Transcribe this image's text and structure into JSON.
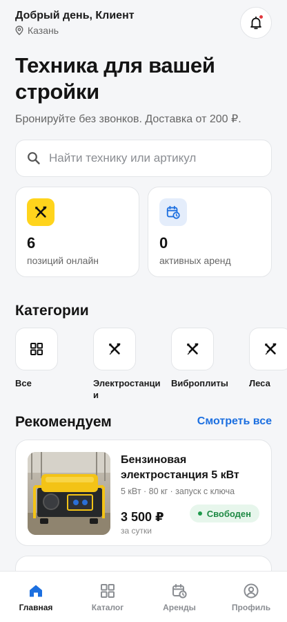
{
  "header": {
    "greeting": "Добрый день, Клиент",
    "city": "Казань",
    "has_notifications": true
  },
  "hero": {
    "title": "Техника для вашей стройки",
    "subtitle": "Бронируйте без звонков. Доставка от 200 ₽."
  },
  "search": {
    "placeholder": "Найти технику или артикул",
    "value": ""
  },
  "stats": [
    {
      "value": "6",
      "label": "позиций онлайн",
      "icon": "tools-icon",
      "color": "#ffd41c"
    },
    {
      "value": "0",
      "label": "активных аренд",
      "icon": "calendar-clock-icon",
      "color": "#e4edfb"
    }
  ],
  "categories": {
    "title": "Категории",
    "items": [
      {
        "label": "Все",
        "icon": "grid-icon"
      },
      {
        "label": "Электростанции",
        "icon": "tools-icon"
      },
      {
        "label": "Виброплиты",
        "icon": "tools-icon"
      },
      {
        "label": "Леса",
        "icon": "tools-icon"
      }
    ]
  },
  "recommended": {
    "title": "Рекомендуем",
    "see_all": "Смотреть все",
    "products": [
      {
        "title": "Бензиновая электростанция 5 кВт",
        "specs": "5 кВт · 80 кг · запуск с ключа",
        "price": "3 500 ₽",
        "unit": "за сутки",
        "status": "Свободен",
        "image": "generator-photo"
      }
    ]
  },
  "tabs": [
    {
      "label": "Главная",
      "icon": "home-icon",
      "active": true
    },
    {
      "label": "Каталог",
      "icon": "grid-icon",
      "active": false
    },
    {
      "label": "Аренды",
      "icon": "calendar-clock-icon",
      "active": false
    },
    {
      "label": "Профиль",
      "icon": "profile-icon",
      "active": false
    }
  ],
  "colors": {
    "accent": "#1c6fe0",
    "yellow": "#ffd41c",
    "status_green": "#1f8a45",
    "notification": "#e0383e"
  }
}
